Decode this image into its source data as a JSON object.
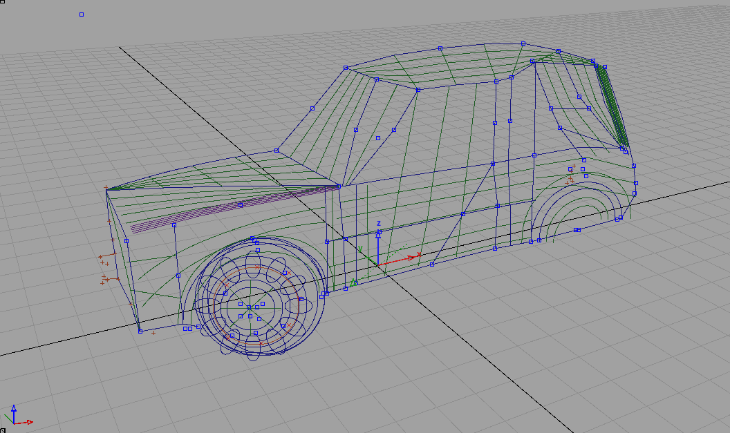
{
  "viewport": {
    "manipulator": {
      "axes": [
        {
          "kind": "vertical",
          "label": "z",
          "color": "#1c1cf0"
        },
        {
          "kind": "depth",
          "label": "y",
          "color": "#1f951f"
        },
        {
          "kind": "horizontal",
          "label": "x",
          "color": "#d41414"
        }
      ]
    }
  }
}
